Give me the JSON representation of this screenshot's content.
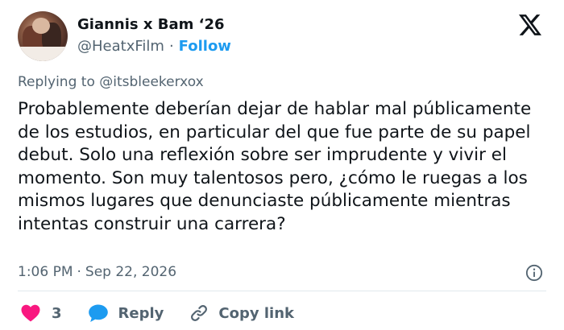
{
  "author": {
    "display_name": "Giannis x Bam ‘26",
    "handle": "@HeatxFilm",
    "separator": "·",
    "follow_label": "Follow"
  },
  "reply_context": "Replying to @itsbleekerxox",
  "tweet": {
    "text": "Probablemente deberían dejar de hablar mal públicamente de los estudios, en particular del que fue parte de su papel debut. Solo una reflexión sobre ser imprudente y vivir el momento. Son muy talentosos pero, ¿cómo le ruegas a los mismos lugares que denunciaste públicamente mientras intentas construir una carrera?"
  },
  "meta": {
    "time": "1:06 PM",
    "separator": "·",
    "date": "Sep 22, 2026"
  },
  "actions": {
    "like_count": "3",
    "reply_label": "Reply",
    "copy_link_label": "Copy link"
  },
  "icons": {
    "brand": "x-logo-icon",
    "info": "info-icon",
    "like": "heart-icon",
    "reply": "speech-bubble-icon",
    "copy": "link-icon"
  },
  "colors": {
    "accent": "#1d9bf0",
    "heart": "#f91880",
    "text": "#0f1419",
    "secondary": "#536471"
  }
}
